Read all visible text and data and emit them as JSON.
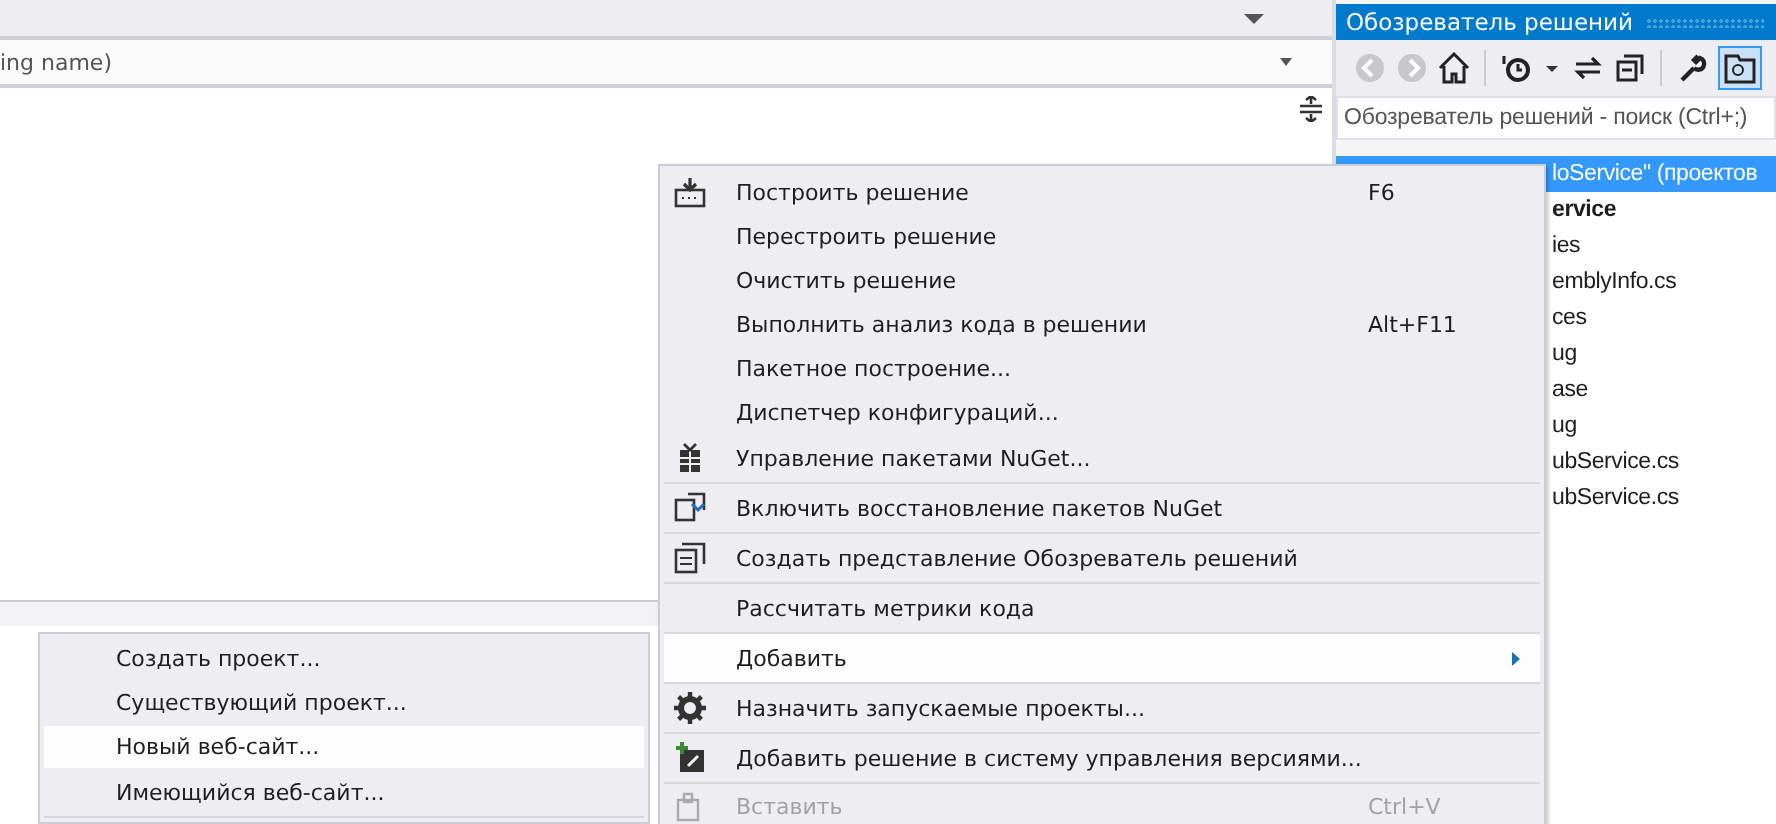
{
  "editor": {
    "combo_value": "ing name)"
  },
  "explorer": {
    "title": "Обозреватель решений",
    "search": {
      "placeholder": "Обозреватель решений - поиск (Ctrl+;)"
    },
    "tree": [
      {
        "label": "loService\"  (проектов",
        "selected": true,
        "bold": false
      },
      {
        "label": "ervice",
        "selected": false,
        "bold": true
      },
      {
        "label": "ies",
        "selected": false,
        "bold": false
      },
      {
        "label": "emblyInfo.cs",
        "selected": false,
        "bold": false
      },
      {
        "label": "ces",
        "selected": false,
        "bold": false
      },
      {
        "label": "ug",
        "selected": false,
        "bold": false
      },
      {
        "label": "ase",
        "selected": false,
        "bold": false
      },
      {
        "label": "ug",
        "selected": false,
        "bold": false
      },
      {
        "label": "ubService.cs",
        "selected": false,
        "bold": false
      },
      {
        "label": "ubService.cs",
        "selected": false,
        "bold": false
      }
    ]
  },
  "context_menu": [
    {
      "kind": "build",
      "label": "Построить решение",
      "shortcut": "F6",
      "hovered": false,
      "disabled": false,
      "separator_after": false
    },
    {
      "kind": "item",
      "label": "Перестроить решение",
      "hovered": false,
      "disabled": false,
      "separator_after": false
    },
    {
      "kind": "item",
      "label": "Очистить решение",
      "hovered": false,
      "disabled": false,
      "separator_after": false
    },
    {
      "kind": "item",
      "label": "Выполнить анализ кода в решении",
      "shortcut": "Alt+F11",
      "hovered": false,
      "disabled": false,
      "separator_after": false
    },
    {
      "kind": "item",
      "label": "Пакетное построение...",
      "hovered": false,
      "disabled": false,
      "separator_after": false
    },
    {
      "kind": "item",
      "label": "Диспетчер конфигураций...",
      "hovered": false,
      "disabled": false,
      "separator_after": false
    },
    {
      "kind": "package",
      "label": "Управление пакетами NuGet...",
      "hovered": false,
      "disabled": false,
      "separator_after": true
    },
    {
      "kind": "restore",
      "label": "Включить восстановление пакетов NuGet",
      "hovered": false,
      "disabled": false,
      "separator_after": true
    },
    {
      "kind": "view",
      "label": "Создать представление Обозреватель решений",
      "hovered": false,
      "disabled": false,
      "separator_after": true
    },
    {
      "kind": "item",
      "label": "Рассчитать метрики кода",
      "hovered": false,
      "disabled": false,
      "separator_after": true
    },
    {
      "kind": "submenu",
      "label": "Добавить",
      "hovered": true,
      "disabled": false,
      "separator_after": true
    },
    {
      "kind": "gear",
      "label": "Назначить запускаемые проекты...",
      "hovered": false,
      "disabled": false,
      "separator_after": true
    },
    {
      "kind": "vcs",
      "label": "Добавить решение в систему управления версиями...",
      "hovered": false,
      "disabled": false,
      "separator_after": true
    },
    {
      "kind": "paste",
      "label": "Вставить",
      "shortcut": "Ctrl+V",
      "hovered": false,
      "disabled": true,
      "separator_after": false
    }
  ],
  "submenu": [
    {
      "label": "Создать проект...",
      "hovered": false,
      "separator_after": false
    },
    {
      "label": "Существующий проект...",
      "hovered": false,
      "separator_after": false
    },
    {
      "label": "Новый веб-сайт...",
      "hovered": true,
      "separator_after": false
    },
    {
      "label": "Имеющийся веб-сайт...",
      "hovered": false,
      "separator_after": true
    }
  ]
}
